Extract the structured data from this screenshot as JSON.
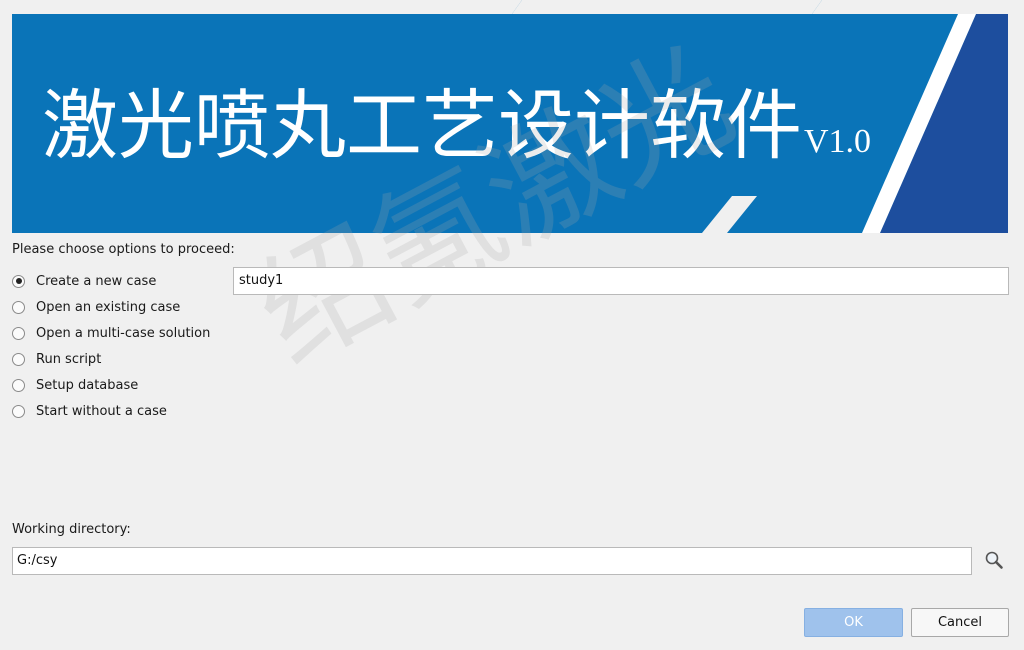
{
  "banner": {
    "title": "激光喷丸工艺设计软件",
    "version": "V1.0",
    "colors": {
      "primary_blue": "#0a74b8",
      "dark_blue": "#1d4e9e",
      "stripe": "#ffffff"
    }
  },
  "watermark": {
    "text": "绍氪激光"
  },
  "options": {
    "prompt": "Please choose options to proceed:",
    "items": [
      {
        "label": "Create a new case",
        "selected": true
      },
      {
        "label": "Open an existing case",
        "selected": false
      },
      {
        "label": "Open a multi-case solution",
        "selected": false
      },
      {
        "label": "Run script",
        "selected": false
      },
      {
        "label": "Setup database",
        "selected": false
      },
      {
        "label": "Start without a case",
        "selected": false
      }
    ],
    "case_name_value": "study1"
  },
  "working_directory": {
    "label": "Working directory:",
    "value": "G:/csy",
    "browse_icon": "magnifier-icon"
  },
  "buttons": {
    "ok_label": "OK",
    "ok_enabled": false,
    "cancel_label": "Cancel"
  }
}
